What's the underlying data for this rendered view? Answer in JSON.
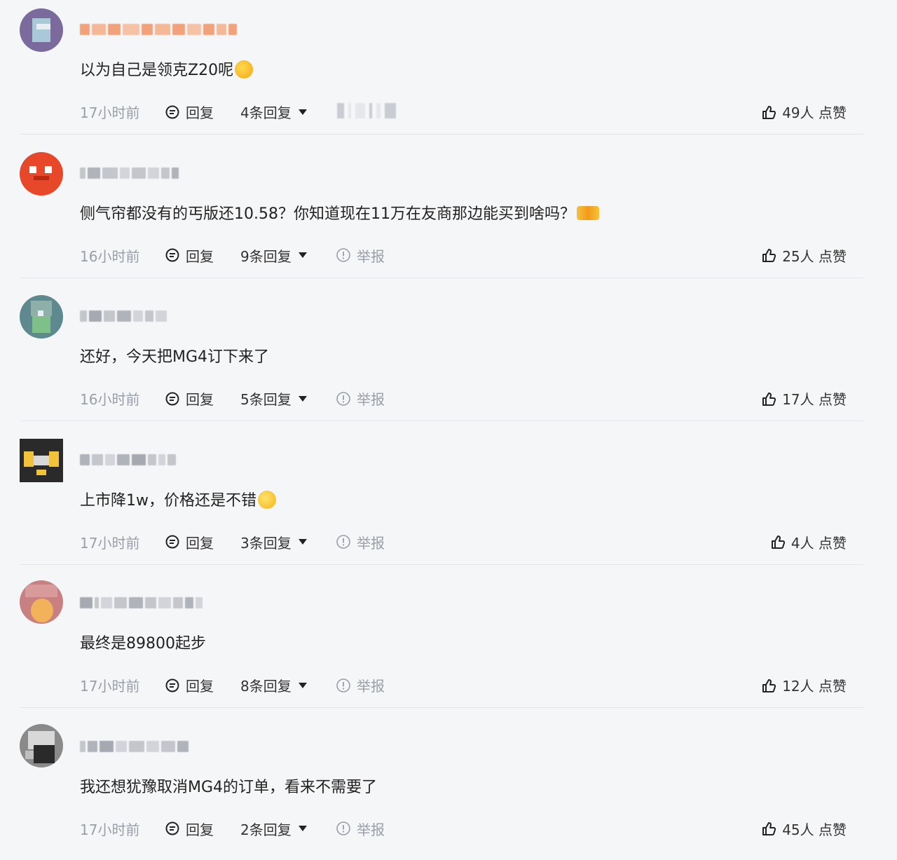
{
  "comments": [
    {
      "text": "以为自己是领克Z20呢",
      "emoji": "rofl-emoji",
      "time": "17小时前",
      "reply_label": "回复",
      "replies_label": "4条回复",
      "report_label": "",
      "likes_label": "49人 点赞"
    },
    {
      "text": "侧气帘都没有的丐版还10.58？你知道现在11万在友商那边能买到啥吗？",
      "emoji": "fire-emoji",
      "time": "16小时前",
      "reply_label": "回复",
      "replies_label": "9条回复",
      "report_label": "举报",
      "likes_label": "25人 点赞"
    },
    {
      "text": "还好，今天把MG4订下来了",
      "emoji": "",
      "time": "16小时前",
      "reply_label": "回复",
      "replies_label": "5条回复",
      "report_label": "举报",
      "likes_label": "17人 点赞"
    },
    {
      "text": "上市降1w，价格还是不错",
      "emoji": "smile-emoji",
      "time": "17小时前",
      "reply_label": "回复",
      "replies_label": "3条回复",
      "report_label": "举报",
      "likes_label": "4人 点赞"
    },
    {
      "text": "最终是89800起步",
      "emoji": "",
      "time": "17小时前",
      "reply_label": "回复",
      "replies_label": "8条回复",
      "report_label": "举报",
      "likes_label": "12人 点赞"
    },
    {
      "text": "我还想犹豫取消MG4的订单，看来不需要了",
      "emoji": "",
      "time": "17小时前",
      "reply_label": "回复",
      "replies_label": "2条回复",
      "report_label": "举报",
      "likes_label": "45人 点赞"
    }
  ],
  "colors": {
    "avatar_1": "#7a6b9c",
    "avatar_2": "#e8482a",
    "avatar_3": "#5e8a8f",
    "avatar_4": "#2a2a2a",
    "avatar_5": "#c88080",
    "avatar_6": "#8a8a8a",
    "username_1": "#f2a27a",
    "username_2": "#c4c6cc",
    "username_3": "#c4c6cc",
    "username_4": "#c4c6cc",
    "username_5": "#c4c6cc",
    "username_6": "#c4c6cc"
  }
}
